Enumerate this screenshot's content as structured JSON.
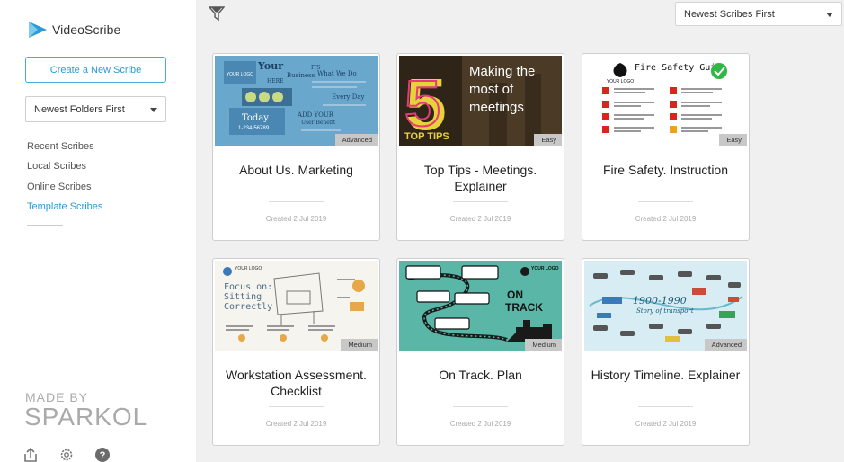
{
  "app": {
    "name": "VideoScribe"
  },
  "sidebar": {
    "create_label": "Create a New Scribe",
    "folder_sort": "Newest Folders First",
    "nav": [
      {
        "label": "Recent Scribes",
        "active": false
      },
      {
        "label": "Local Scribes",
        "active": false
      },
      {
        "label": "Online Scribes",
        "active": false
      },
      {
        "label": "Template Scribes",
        "active": true
      }
    ],
    "made_by": "MADE BY",
    "brand": "SPARKOL"
  },
  "toolbar": {
    "sort": "Newest Scribes First"
  },
  "cards": [
    {
      "title": "About Us. Marketing",
      "date": "Created 2 Jul 2019",
      "level": "Advanced"
    },
    {
      "title": "Top Tips - Meetings. Explainer",
      "date": "Created 2 Jul 2019",
      "level": "Easy"
    },
    {
      "title": "Fire Safety. Instruction",
      "date": "Created 2 Jul 2019",
      "level": "Easy"
    },
    {
      "title": "Workstation Assessment. Checklist",
      "date": "Created 2 Jul 2019",
      "level": "Medium"
    },
    {
      "title": "On Track. Plan",
      "date": "Created 2 Jul 2019",
      "level": "Medium"
    },
    {
      "title": "History Timeline. Explainer",
      "date": "Created 2 Jul 2019",
      "level": "Advanced"
    }
  ],
  "thumbnails": {
    "about": {
      "line1": "Your",
      "line2": "Business",
      "line3": "HERE",
      "its": "ITS",
      "what": "What We Do",
      "every": "Every Day",
      "today": "Today",
      "phone": "1-234-56789",
      "add": "ADD YOUR",
      "benefit": "User Benefit",
      "logo": "YOUR LOGO"
    },
    "tips": {
      "number": "5",
      "line1": "Making the",
      "line2": "most of",
      "line3": "meetings",
      "top": "TOP TIPS"
    },
    "fire": {
      "title": "Fire Safety Guide",
      "logo": "YOUR LOGO"
    },
    "work": {
      "logo": "YOUR LOGO",
      "line1": "Focus on:",
      "line2": "Sitting",
      "line3": "Correctly"
    },
    "track": {
      "line1": "ON",
      "line2": "TRACK",
      "logo": "YOUR LOGO"
    },
    "history": {
      "years": "1900-1990",
      "sub": "Story of transport"
    }
  },
  "colors": {
    "accent": "#2b9bd3",
    "badge": "#c8c8c8"
  }
}
